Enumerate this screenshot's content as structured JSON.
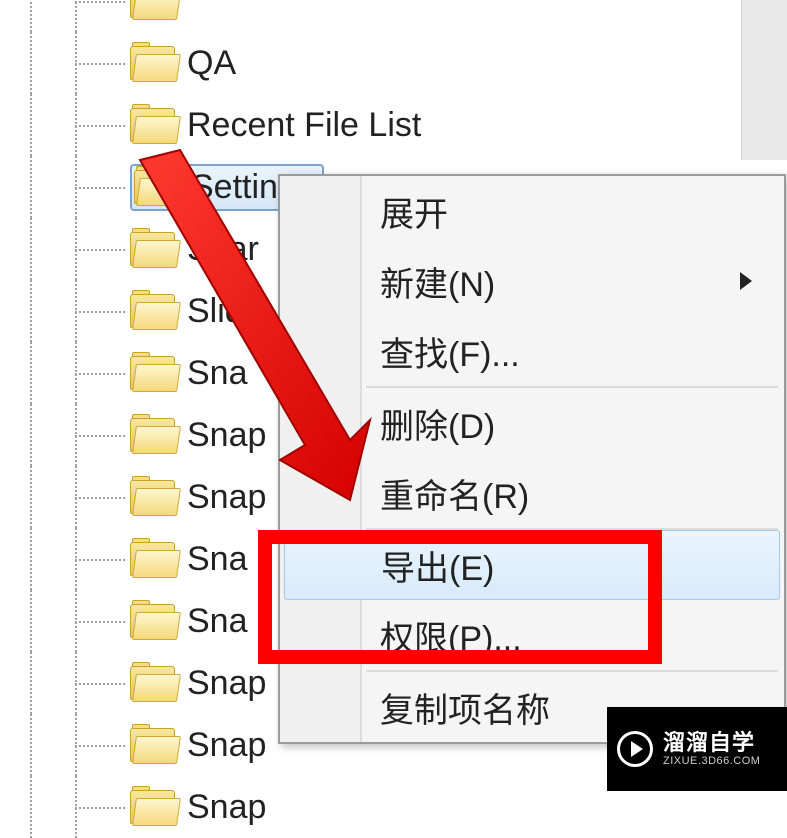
{
  "tree": {
    "items": [
      {
        "label": ""
      },
      {
        "label": "QA"
      },
      {
        "label": "Recent File List"
      },
      {
        "label": "Settings",
        "selected": true
      },
      {
        "label": "Shar"
      },
      {
        "label": "Slide"
      },
      {
        "label": "Sna"
      },
      {
        "label": "Snap"
      },
      {
        "label": "Snap"
      },
      {
        "label": "Sna"
      },
      {
        "label": "Sna"
      },
      {
        "label": "Snap"
      },
      {
        "label": "Snap"
      },
      {
        "label": "Snap"
      }
    ]
  },
  "menu": {
    "expand": "展开",
    "new": "新建(N)",
    "find": "查找(F)...",
    "delete": "删除(D)",
    "rename": "重命名(R)",
    "export": "导出(E)",
    "permissions": "权限(P)...",
    "copy_name": "复制项名称"
  },
  "watermark": {
    "line1": "溜溜自学",
    "line2": "ZIXUE.3D66.COM"
  },
  "highlight_color": "#ff0000"
}
